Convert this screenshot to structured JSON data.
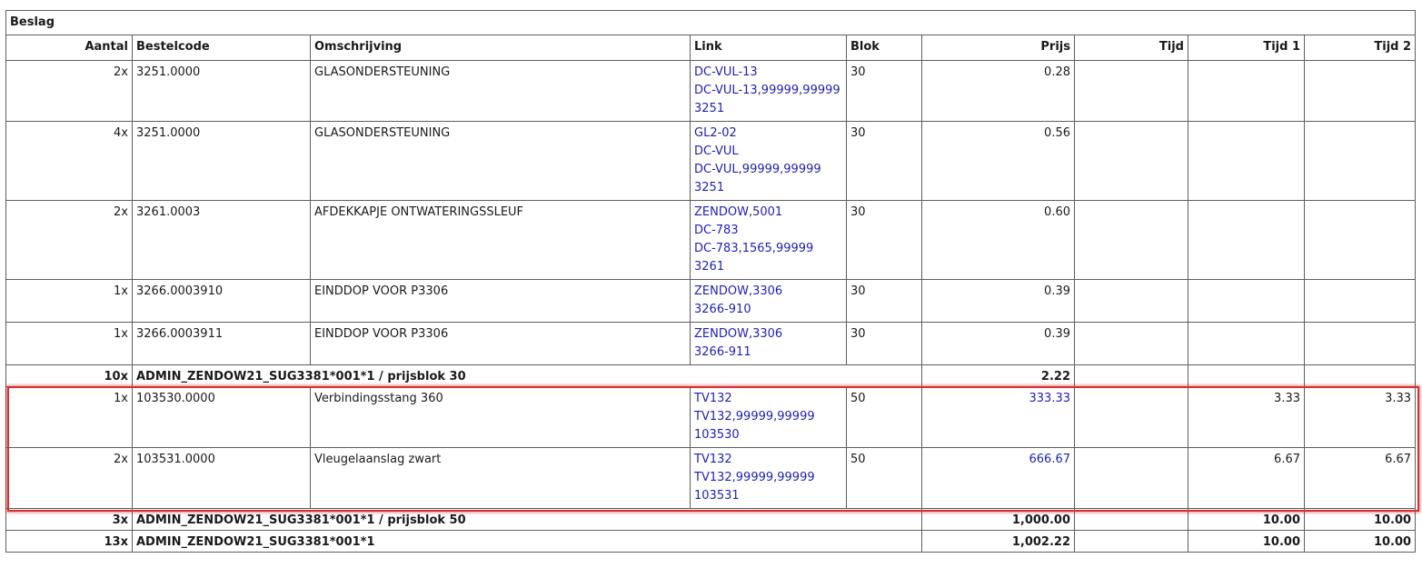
{
  "section_title": "Beslag",
  "headers": {
    "aantal": "Aantal",
    "bestelcode": "Bestelcode",
    "omschrijving": "Omschrijving",
    "link": "Link",
    "blok": "Blok",
    "prijs": "Prijs",
    "tijd": "Tijd",
    "tijd1": "Tijd 1",
    "tijd2": "Tijd 2"
  },
  "rows": [
    {
      "aantal": "2x",
      "bestelcode": "3251.0000",
      "omschrijving": "GLASONDERSTEUNING",
      "link": [
        "DC-VUL-13",
        "DC-VUL-13,99999,99999",
        "3251"
      ],
      "blok": "30",
      "prijs": "0.28",
      "tijd": "",
      "tijd1": "",
      "tijd2": ""
    },
    {
      "aantal": "4x",
      "bestelcode": "3251.0000",
      "omschrijving": "GLASONDERSTEUNING",
      "link": [
        "GL2-02",
        "DC-VUL",
        "DC-VUL,99999,99999",
        "3251"
      ],
      "blok": "30",
      "prijs": "0.56",
      "tijd": "",
      "tijd1": "",
      "tijd2": ""
    },
    {
      "aantal": "2x",
      "bestelcode": "3261.0003",
      "omschrijving": "AFDEKKAPJE ONTWATERINGSSLEUF",
      "link": [
        "ZENDOW,5001",
        "DC-783",
        "DC-783,1565,99999",
        "3261"
      ],
      "blok": "30",
      "prijs": "0.60",
      "tijd": "",
      "tijd1": "",
      "tijd2": ""
    },
    {
      "aantal": "1x",
      "bestelcode": "3266.0003910",
      "omschrijving": "EINDDOP VOOR P3306",
      "link": [
        "ZENDOW,3306",
        "3266-910"
      ],
      "blok": "30",
      "prijs": "0.39",
      "tijd": "",
      "tijd1": "",
      "tijd2": ""
    },
    {
      "aantal": "1x",
      "bestelcode": "3266.0003911",
      "omschrijving": "EINDDOP VOOR P3306",
      "link": [
        "ZENDOW,3306",
        "3266-911"
      ],
      "blok": "30",
      "prijs": "0.39",
      "tijd": "",
      "tijd1": "",
      "tijd2": ""
    }
  ],
  "subtotal_30": {
    "aantal": "10x",
    "label": "ADMIN_ZENDOW21_SUG3381*001*1 / prijsblok 30",
    "prijs": "2.22",
    "tijd1": "",
    "tijd2": ""
  },
  "rows_50": [
    {
      "aantal": "1x",
      "bestelcode": "103530.0000",
      "omschrijving": "Verbindingsstang 360",
      "link": [
        "TV132",
        "TV132,99999,99999",
        "103530"
      ],
      "blok": "50",
      "prijs": "333.33",
      "tijd": "",
      "tijd1": "3.33",
      "tijd2": "3.33"
    },
    {
      "aantal": "2x",
      "bestelcode": "103531.0000",
      "omschrijving": "Vleugelaanslag zwart",
      "link": [
        "TV132",
        "TV132,99999,99999",
        "103531"
      ],
      "blok": "50",
      "prijs": "666.67",
      "tijd": "",
      "tijd1": "6.67",
      "tijd2": "6.67"
    }
  ],
  "subtotal_50": {
    "aantal": "3x",
    "label": "ADMIN_ZENDOW21_SUG3381*001*1 / prijsblok 50",
    "prijs": "1,000.00",
    "tijd1": "10.00",
    "tijd2": "10.00"
  },
  "total": {
    "aantal": "13x",
    "label": "ADMIN_ZENDOW21_SUG3381*001*1",
    "prijs": "1,002.22",
    "tijd1": "10.00",
    "tijd2": "10.00"
  },
  "colors": {
    "link": "#1f1fb8",
    "highlight": "#d9302f",
    "border": "#5e5e5e"
  }
}
